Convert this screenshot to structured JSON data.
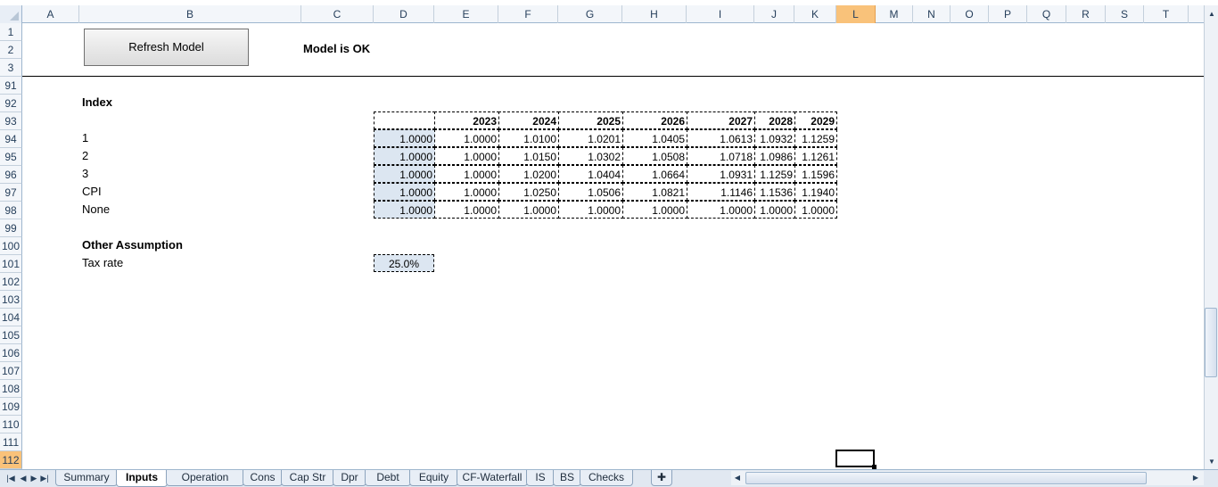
{
  "columns": [
    "A",
    "B",
    "C",
    "D",
    "E",
    "F",
    "G",
    "H",
    "I",
    "J",
    "K",
    "L",
    "M",
    "N",
    "O",
    "P",
    "Q",
    "R",
    "S",
    "T"
  ],
  "selected_column": "L",
  "rows": [
    "1",
    "2",
    "3",
    "91",
    "92",
    "93",
    "94",
    "95",
    "96",
    "97",
    "98",
    "99",
    "100",
    "101",
    "102",
    "103",
    "104",
    "105",
    "106",
    "107",
    "108",
    "109",
    "110",
    "111",
    "112"
  ],
  "selected_row": "112",
  "button": {
    "label": "Refresh Model"
  },
  "status": "Model is OK",
  "index": {
    "title": "Index",
    "years": [
      "2023",
      "2024",
      "2025",
      "2026",
      "2027",
      "2028",
      "2029"
    ],
    "rows": [
      {
        "label": "1",
        "base": "1.0000",
        "values": [
          "1.0000",
          "1.0100",
          "1.0201",
          "1.0405",
          "1.0613",
          "1.0932",
          "1.1259"
        ]
      },
      {
        "label": "2",
        "base": "1.0000",
        "values": [
          "1.0000",
          "1.0150",
          "1.0302",
          "1.0508",
          "1.0718",
          "1.0986",
          "1.1261"
        ]
      },
      {
        "label": "3",
        "base": "1.0000",
        "values": [
          "1.0000",
          "1.0200",
          "1.0404",
          "1.0664",
          "1.0931",
          "1.1259",
          "1.1596"
        ]
      },
      {
        "label": "CPI",
        "base": "1.0000",
        "values": [
          "1.0000",
          "1.0250",
          "1.0506",
          "1.0821",
          "1.1146",
          "1.1536",
          "1.1940"
        ]
      },
      {
        "label": "None",
        "base": "1.0000",
        "values": [
          "1.0000",
          "1.0000",
          "1.0000",
          "1.0000",
          "1.0000",
          "1.0000",
          "1.0000"
        ]
      }
    ]
  },
  "other": {
    "title": "Other Assumption",
    "tax_label": "Tax rate",
    "tax_value": "25.0%"
  },
  "sheet_tabs": [
    "Summary",
    "Inputs",
    "Operation",
    "Cons",
    "Cap Str",
    "Dpr",
    "Debt",
    "Equity",
    "CF-Waterfall",
    "IS",
    "BS",
    "Checks"
  ],
  "active_tab": "Inputs",
  "colors": {
    "header_bg": "#f3f6fa",
    "selected_header": "#f9c27a",
    "input_cell": "#dce6f1"
  }
}
